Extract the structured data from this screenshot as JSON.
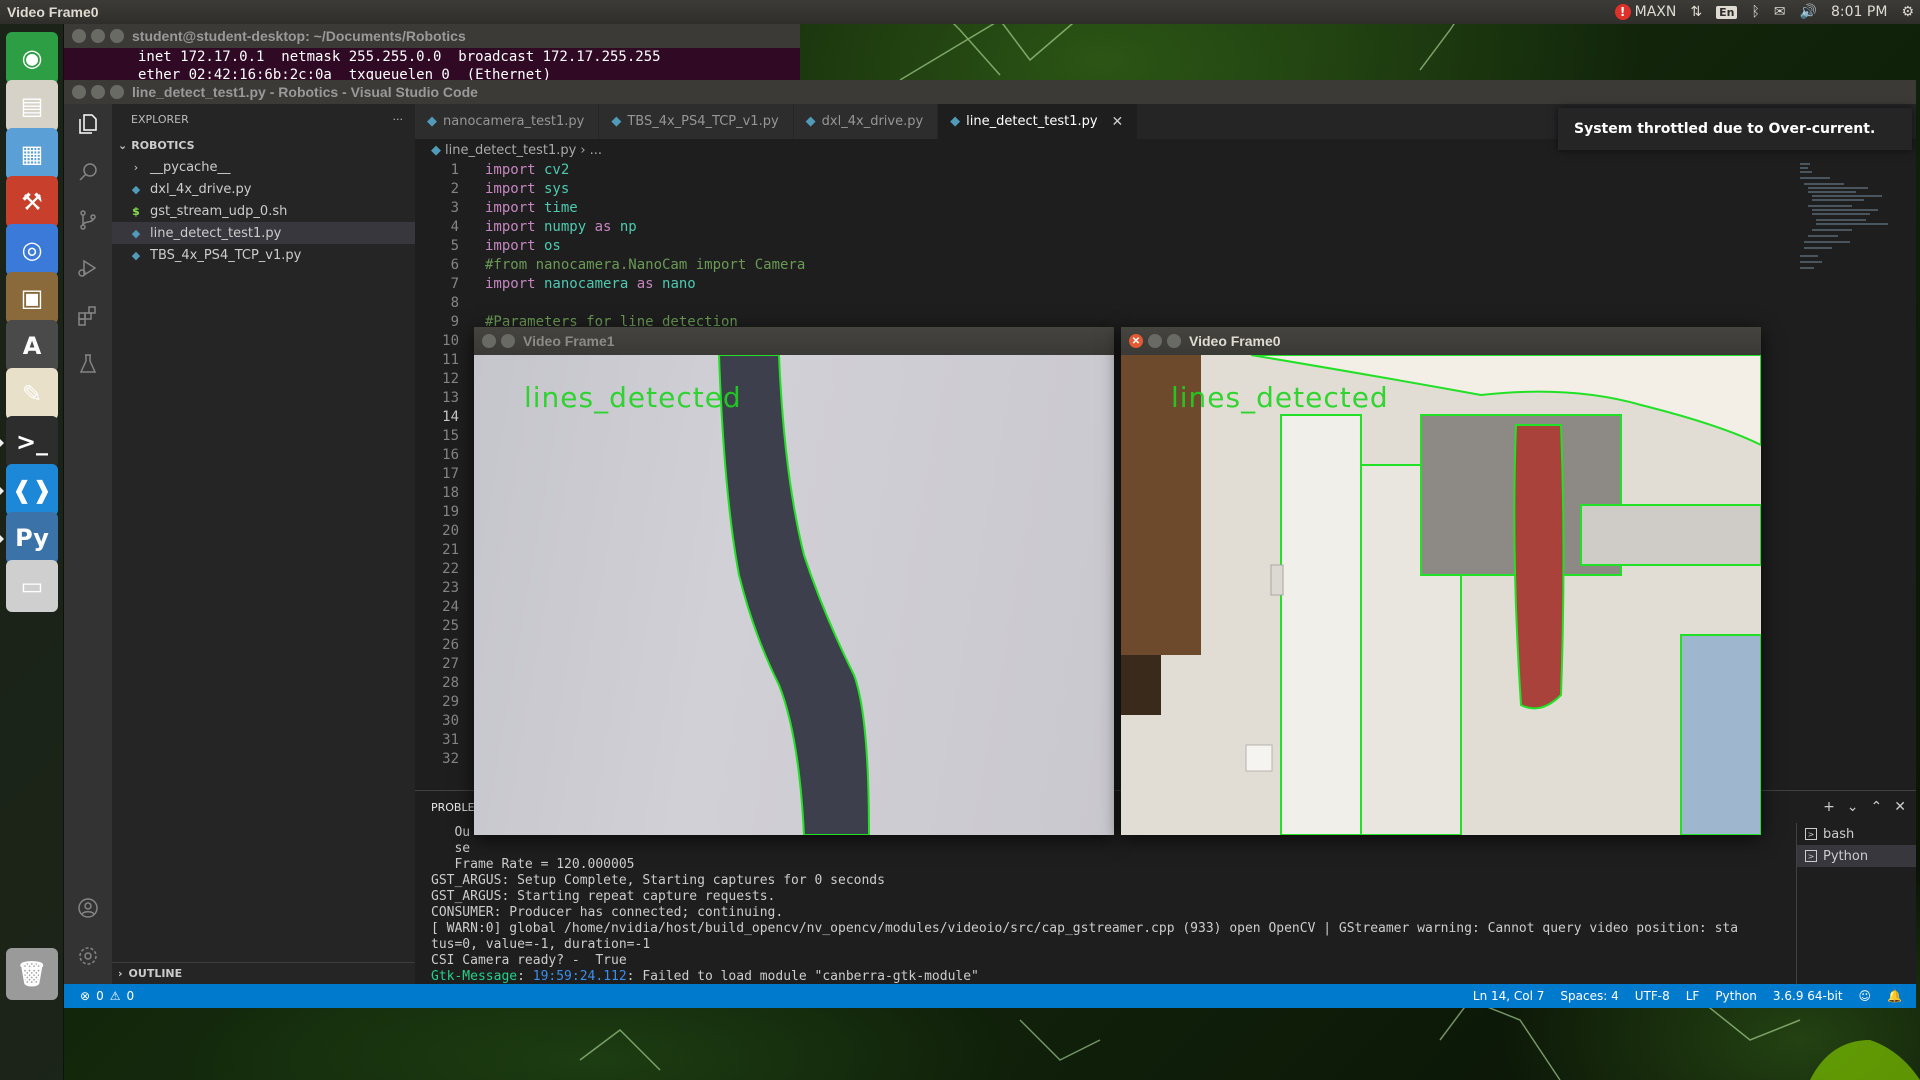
{
  "top_panel": {
    "app_title": "Video Frame0",
    "power_mode": "MAXN",
    "keyboard_layout": "En",
    "clock": "8:01 PM"
  },
  "launcher": {
    "items": [
      {
        "name": "ubuntu-home-icon",
        "color": "#2d9e44"
      },
      {
        "name": "files-icon",
        "color": "#d6d2c8"
      },
      {
        "name": "archive-icon",
        "color": "#5aa0d6"
      },
      {
        "name": "system-settings-icon",
        "color": "#c8402c"
      },
      {
        "name": "chromium-icon",
        "color": "#3b7ad9"
      },
      {
        "name": "map-files-icon",
        "color": "#8a6a3a"
      },
      {
        "name": "software-updater-icon",
        "color": "#4a4a4a"
      },
      {
        "name": "text-editor-icon",
        "color": "#e8e0c8"
      },
      {
        "name": "terminal-icon",
        "color": "#2d2d2d"
      },
      {
        "name": "vscode-icon",
        "color": "#1e88d8"
      },
      {
        "name": "python-icon",
        "color": "#3b72a8"
      },
      {
        "name": "drive-icon",
        "color": "#cfcfcf"
      },
      {
        "name": "trash-icon",
        "color": "#9a9a9a"
      }
    ]
  },
  "terminal": {
    "title": "student@student-desktop: ~/Documents/Robotics",
    "line1": "inet 172.17.0.1  netmask 255.255.0.0  broadcast 172.17.255.255",
    "line2": "ether 02:42:16:6b:2c:0a  txqueuelen 0  (Ethernet)"
  },
  "vscode": {
    "title": "line_detect_test1.py - Robotics - Visual Studio Code",
    "explorer_label": "EXPLORER",
    "explorer_more": "···",
    "folder_label": "ROBOTICS",
    "tree": [
      {
        "label": "__pycache__",
        "type": "folder"
      },
      {
        "label": "dxl_4x_drive.py",
        "type": "py"
      },
      {
        "label": "gst_stream_udp_0.sh",
        "type": "sh"
      },
      {
        "label": "line_detect_test1.py",
        "type": "py",
        "selected": true
      },
      {
        "label": "TBS_4x_PS4_TCP_v1.py",
        "type": "py"
      }
    ],
    "outline_label": "OUTLINE",
    "tabs": [
      {
        "label": "nanocamera_test1.py"
      },
      {
        "label": "TBS_4x_PS4_TCP_v1.py"
      },
      {
        "label": "dxl_4x_drive.py"
      },
      {
        "label": "line_detect_test1.py",
        "active": true
      }
    ],
    "breadcrumb": {
      "file": "line_detect_test1.py",
      "rest": "..."
    },
    "code_lines": [
      [
        {
          "t": "import",
          "c": "kw"
        },
        {
          "t": " cv2",
          "c": "mod"
        }
      ],
      [
        {
          "t": "import",
          "c": "kw"
        },
        {
          "t": " sys",
          "c": "mod"
        }
      ],
      [
        {
          "t": "import",
          "c": "kw"
        },
        {
          "t": " time",
          "c": "mod"
        }
      ],
      [
        {
          "t": "import",
          "c": "kw"
        },
        {
          "t": " numpy",
          "c": "mod"
        },
        {
          "t": " as ",
          "c": "kw"
        },
        {
          "t": "np",
          "c": "mod"
        }
      ],
      [
        {
          "t": "import",
          "c": "kw"
        },
        {
          "t": " os",
          "c": "mod"
        }
      ],
      [
        {
          "t": "#from nanocamera.NanoCam import Camera",
          "c": "cmt"
        }
      ],
      [
        {
          "t": "import",
          "c": "kw"
        },
        {
          "t": " nanocamera",
          "c": "mod"
        },
        {
          "t": " as ",
          "c": "kw"
        },
        {
          "t": "nano",
          "c": "mod"
        }
      ],
      [],
      [
        {
          "t": "#Parameters for line detection",
          "c": "cmt"
        }
      ]
    ],
    "line_numbers": [
      "1",
      "2",
      "3",
      "4",
      "5",
      "6",
      "7",
      "8",
      "9",
      "10",
      "11",
      "12",
      "13",
      "14",
      "15",
      "16",
      "17",
      "18",
      "19",
      "20",
      "21",
      "22",
      "23",
      "24",
      "25",
      "26",
      "27",
      "28",
      "29",
      "30",
      "31",
      "32"
    ],
    "current_line": "14",
    "notification": "System throttled due to Over-current.",
    "panel_label": "PROBLE",
    "terminal_output": [
      "   Ou",
      "   se",
      "   Frame Rate = 120.000005",
      "GST_ARGUS: Setup Complete, Starting captures for 0 seconds",
      "GST_ARGUS: Starting repeat capture requests.",
      "CONSUMER: Producer has connected; continuing.",
      "[ WARN:0] global /home/nvidia/host/build_opencv/nv_opencv/modules/videoio/src/cap_gstreamer.cpp (933) open OpenCV | GStreamer warning: Cannot query video position: sta",
      "tus=0, value=-1, duration=-1",
      "CSI Camera ready? -  True"
    ],
    "gtk_prefix": "Gtk-Message",
    "gtk_time": "19:59:24.112",
    "gtk_rest": ": Failed to load module \"canberra-gtk-module\"",
    "terminals": [
      {
        "label": "bash"
      },
      {
        "label": "Python",
        "active": true
      }
    ],
    "status": {
      "errors": "0",
      "warnings": "0",
      "position": "Ln 14, Col 7",
      "spaces": "Spaces: 4",
      "encoding": "UTF-8",
      "eol": "LF",
      "language": "Python",
      "interpreter": "3.6.9 64-bit"
    }
  },
  "video_frame1": {
    "title": "Video Frame1",
    "overlay": "lines_detected"
  },
  "video_frame0": {
    "title": "Video Frame0",
    "overlay": "lines_detected"
  },
  "colors": {
    "accent": "#007acc",
    "detection": "#1fd420",
    "ubuntu_orange": "#e25a33"
  }
}
